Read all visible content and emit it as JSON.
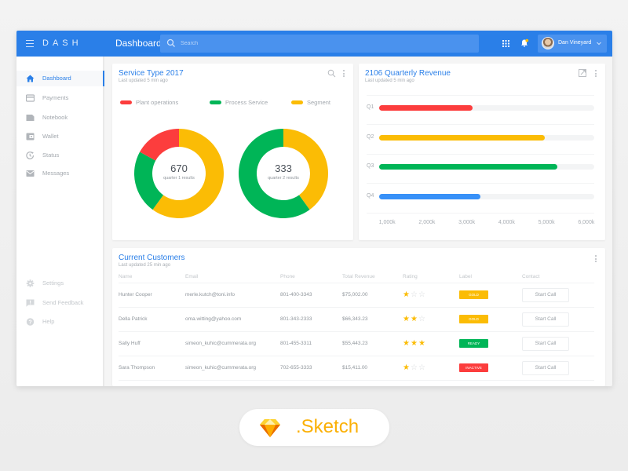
{
  "app": {
    "brand": "DASH",
    "page_title": "Dashboard",
    "search_placeholder": "Search",
    "user_name": "Dan Vineyard"
  },
  "colors": {
    "primary": "#2a7fe8",
    "red": "#fc3d3d",
    "green": "#00b557",
    "yellow": "#fbbc05",
    "blue": "#3891f8"
  },
  "sidebar": {
    "items": [
      {
        "label": "Dashboard",
        "icon": "home-icon",
        "active": true
      },
      {
        "label": "Payments",
        "icon": "credit-card-icon"
      },
      {
        "label": "Notebook",
        "icon": "notebook-icon"
      },
      {
        "label": "Wallet",
        "icon": "wallet-icon"
      },
      {
        "label": "Status",
        "icon": "status-icon"
      },
      {
        "label": "Messages",
        "icon": "mail-icon"
      }
    ],
    "footer_items": [
      {
        "label": "Settings",
        "icon": "gear-icon"
      },
      {
        "label": "Send Feedback",
        "icon": "feedback-icon"
      },
      {
        "label": "Help",
        "icon": "help-icon"
      }
    ]
  },
  "service_card": {
    "title": "Service Type 2017",
    "subtitle": "Last updated 5 min ago",
    "legend": [
      "Plant operations",
      "Process Service",
      "Segment"
    ],
    "donuts": [
      {
        "value": "670",
        "label": "quarter 1 results"
      },
      {
        "value": "333",
        "label": "quarter 2 results"
      }
    ]
  },
  "revenue_card": {
    "title": "2106 Quarterly Revenue",
    "subtitle": "Last updated 5 min ago"
  },
  "customers_card": {
    "title": "Current Customers",
    "subtitle": "Last updated 25 min ago",
    "columns": [
      "Name",
      "Email",
      "Phone",
      "Total Revenue",
      "Rating",
      "Label",
      "Contact"
    ],
    "rows": [
      {
        "name": "Hunter Cooper",
        "email": "merle.kutch@toni.info",
        "phone": "801-400-3343",
        "revenue": "$75,002.00",
        "rating": 1,
        "label": "GOLD",
        "label_color": "#fbbc05",
        "contact": "Start Call"
      },
      {
        "name": "Della Patrick",
        "email": "oma.witting@yahoo.com",
        "phone": "801-343-2333",
        "revenue": "$66,343.23",
        "rating": 2,
        "label": "GOLD",
        "label_color": "#fbbc05",
        "contact": "Start Call"
      },
      {
        "name": "Sally Huff",
        "email": "simeon_kuhic@cummerata.org",
        "phone": "801-455-3311",
        "revenue": "$55,443.23",
        "rating": 3,
        "label": "READY",
        "label_color": "#00b557",
        "contact": "Start Call"
      },
      {
        "name": "Sara Thompson",
        "email": "simeon_kuhic@cummerata.org",
        "phone": "702-655-3333",
        "revenue": "$15,411.00",
        "rating": 1,
        "label": "INACTIVE",
        "label_color": "#fc3d3d",
        "contact": "Start Call"
      }
    ],
    "rating_max": 3
  },
  "footer_badge": {
    "text": ".Sketch"
  },
  "chart_data": [
    {
      "type": "pie",
      "title": "quarter 1 results",
      "center_value": 670,
      "labels": [
        "Segment",
        "Process Service",
        "Plant operations"
      ],
      "values": [
        60,
        23,
        17
      ],
      "colors": [
        "#fbbc05",
        "#00b557",
        "#fc3d3d"
      ]
    },
    {
      "type": "pie",
      "title": "quarter 2 results",
      "center_value": 333,
      "labels": [
        "Segment",
        "Process Service"
      ],
      "values": [
        40,
        60
      ],
      "colors": [
        "#fbbc05",
        "#00b557"
      ]
    },
    {
      "type": "bar",
      "orientation": "horizontal",
      "title": "2106 Quarterly Revenue",
      "categories": [
        "Q1",
        "Q2",
        "Q3",
        "Q4"
      ],
      "values": [
        3150,
        4950,
        5270,
        3350
      ],
      "colors": [
        "#fc3d3d",
        "#fbbc05",
        "#00b557",
        "#3891f8"
      ],
      "xlim": [
        800,
        6200
      ],
      "xticks": [
        "1,000k",
        "2,000k",
        "3,000k",
        "4,000k",
        "5,000k",
        "6,000k"
      ],
      "xtick_values": [
        1000,
        2000,
        3000,
        4000,
        5000,
        6000
      ],
      "unit": "k",
      "grid": true
    }
  ]
}
